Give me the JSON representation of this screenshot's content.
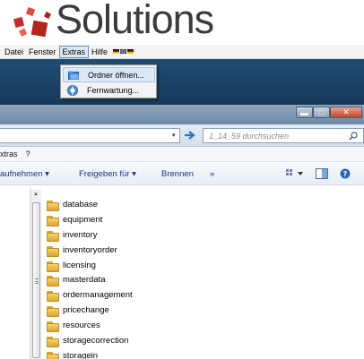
{
  "banner": {
    "logo_text": "Solutions"
  },
  "app_menu": {
    "items": [
      "Datei",
      "Fenster",
      "Extras",
      "Hilfe"
    ],
    "active_item": "Extras",
    "flags": [
      "flag-icon-germany",
      "flag-icon-uk",
      "flag-icon-germany"
    ]
  },
  "extras_menu": {
    "items": [
      {
        "label": "Ordner öffnen...",
        "icon": "folder-open-icon"
      },
      {
        "label": "Fernwartung...",
        "icon": "remote-support-icon"
      }
    ]
  },
  "window": {
    "controls": [
      "minimize-icon",
      "maximize-icon",
      "close-icon"
    ]
  },
  "address_bar": {
    "search_placeholder": "1_14_59 durchsuchen",
    "nav_chevron": "▾",
    "go_arrow": "→"
  },
  "explorer_menu": {
    "items": [
      "xtras",
      "?"
    ]
  },
  "toolbar": {
    "items": [
      "aufnehmen ▾",
      "Freigeben für ▾",
      "Brennen",
      "»"
    ],
    "view_toggle": "view-options-icon",
    "preview": "preview-pane-icon",
    "help": "help-icon"
  },
  "folders": [
    "database",
    "equipment",
    "inventory",
    "inventoryorder",
    "licensing",
    "masterdata",
    "ordermanagement",
    "pricechange",
    "resources",
    "storagecorrection",
    "storagein"
  ],
  "colors": {
    "band_blue": "#1f4d74",
    "toolbar_text": "#1e3287",
    "folder_yellow": "#f0c55a"
  }
}
